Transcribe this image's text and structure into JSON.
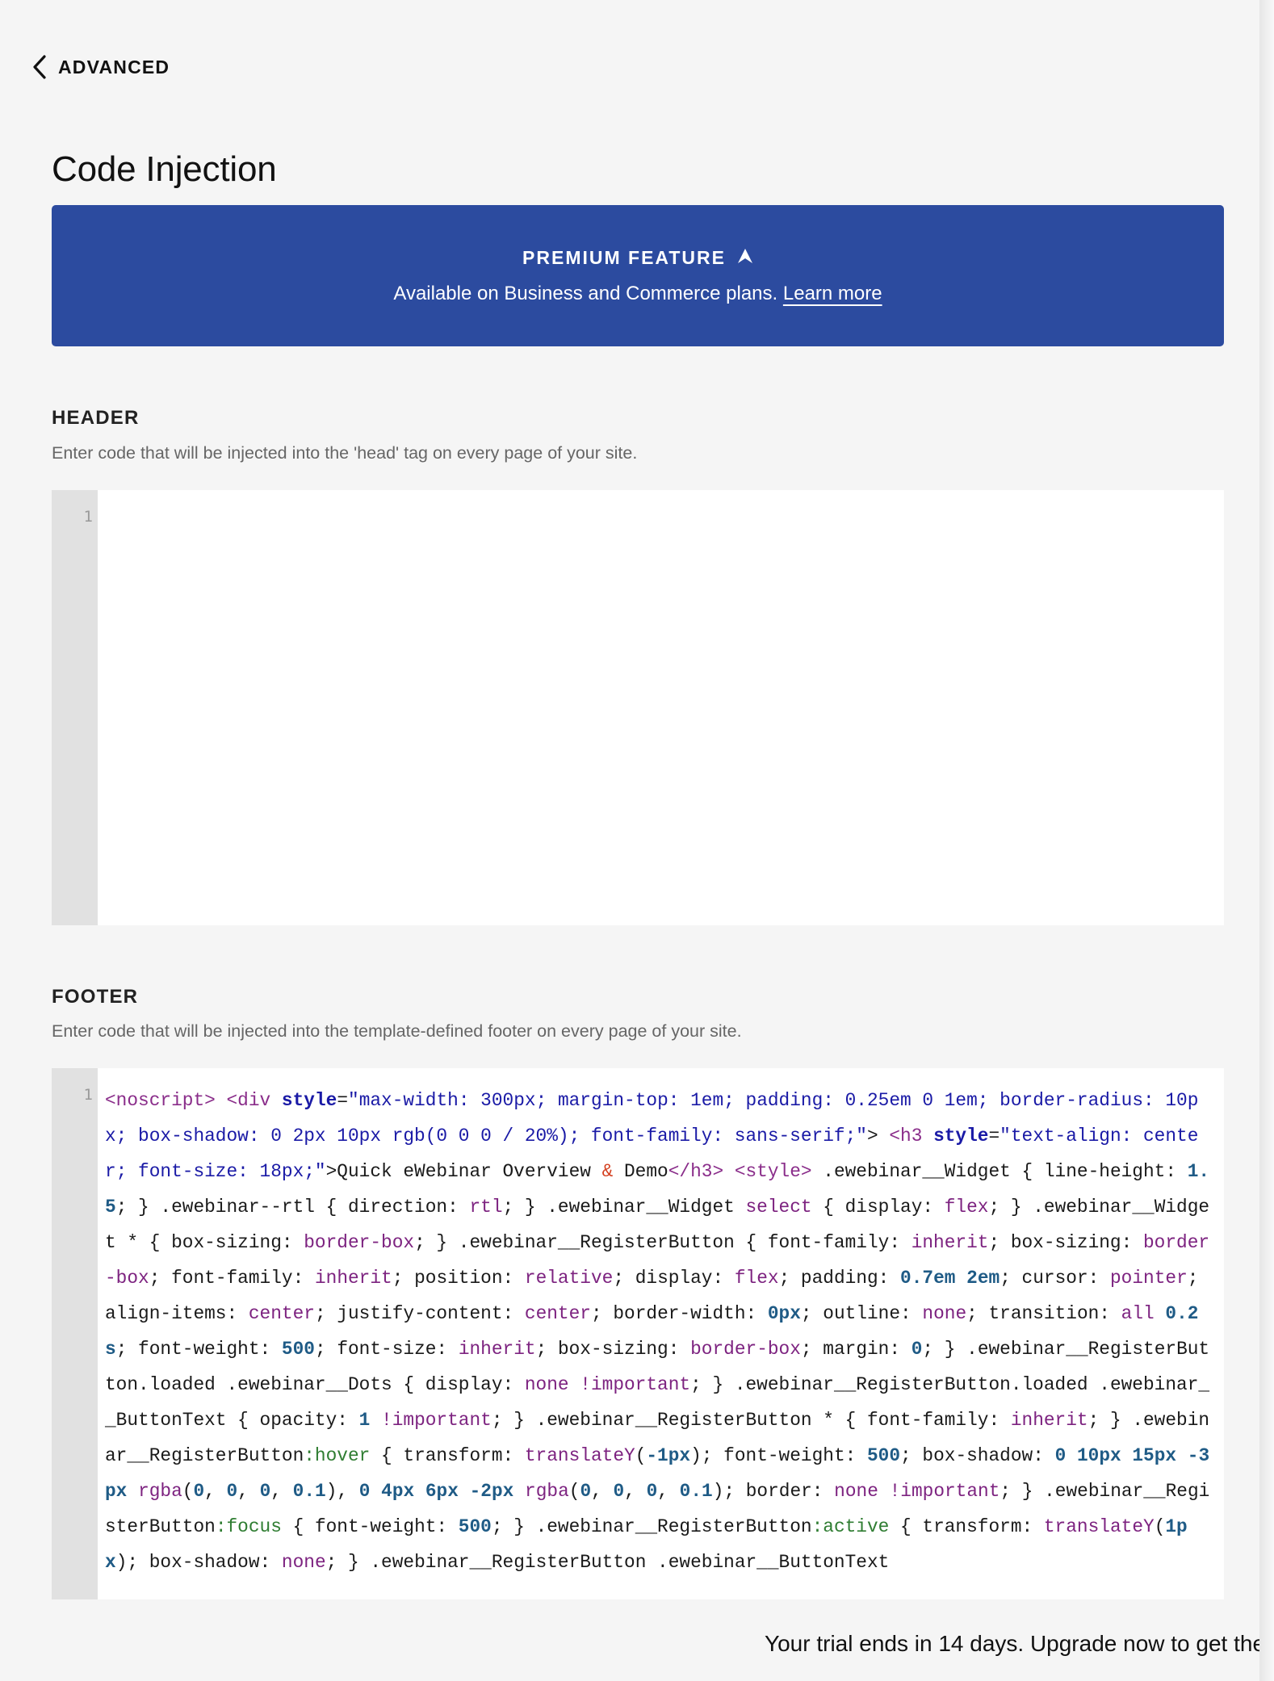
{
  "nav": {
    "back_label": "ADVANCED"
  },
  "page": {
    "title": "Code Injection"
  },
  "premium": {
    "title": "PREMIUM FEATURE",
    "text": "Available on Business and Commerce plans.",
    "link_label": "Learn more",
    "color": "#2c4b9f"
  },
  "header_section": {
    "title": "HEADER",
    "description": "Enter code that will be injected into the 'head' tag on every page of your site.",
    "line_number": "1",
    "code": ""
  },
  "footer_section": {
    "title": "FOOTER",
    "description": "Enter code that will be injected into the template-defined footer on every page of your site.",
    "line_number": "1",
    "code": "<noscript> <div style=\"max-width: 300px; margin-top: 1em; padding: 0.25em 0 1em; border-radius: 10px; box-shadow: 0 2px 10px rgb(0 0 0 / 20%); font-family: sans-serif;\"> <h3 style=\"text-align: center; font-size: 18px;\">Quick eWebinar Overview & Demo</h3> <style> .ewebinar__Widget { line-height: 1.5; } .ewebinar--rtl { direction: rtl; } .ewebinar__Widget select { display: flex; } .ewebinar__Widget * { box-sizing: border-box; } .ewebinar__RegisterButton { font-family: inherit; box-sizing: border-box; font-family: inherit; position: relative; display: flex; padding: 0.7em 2em; cursor: pointer; align-items: center; justify-content: center; border-width: 0px; outline: none; transition: all 0.2s; font-weight: 500; font-size: inherit; box-sizing: border-box; margin: 0; } .ewebinar__RegisterButton.loaded .ewebinar__Dots { display: none !important; } .ewebinar__RegisterButton.loaded .ewebinar__ButtonText { opacity: 1 !important; } .ewebinar__RegisterButton * { font-family: inherit; } .ewebinar__RegisterButton:hover { transform: translateY(-1px); font-weight: 500; box-shadow: 0 10px 15px -3px rgba(0, 0, 0, 0.1), 0 4px 6px -2px rgba(0, 0, 0, 0.1); border: none !important; } .ewebinar__RegisterButton:focus { font-weight: 500; } .ewebinar__RegisterButton:active { transform: translateY(1px); box-shadow: none; } .ewebinar__RegisterButton .ewebinar__ButtonText"
  },
  "trial": {
    "text": "Your trial ends in 14 days. Upgrade now to get the"
  }
}
